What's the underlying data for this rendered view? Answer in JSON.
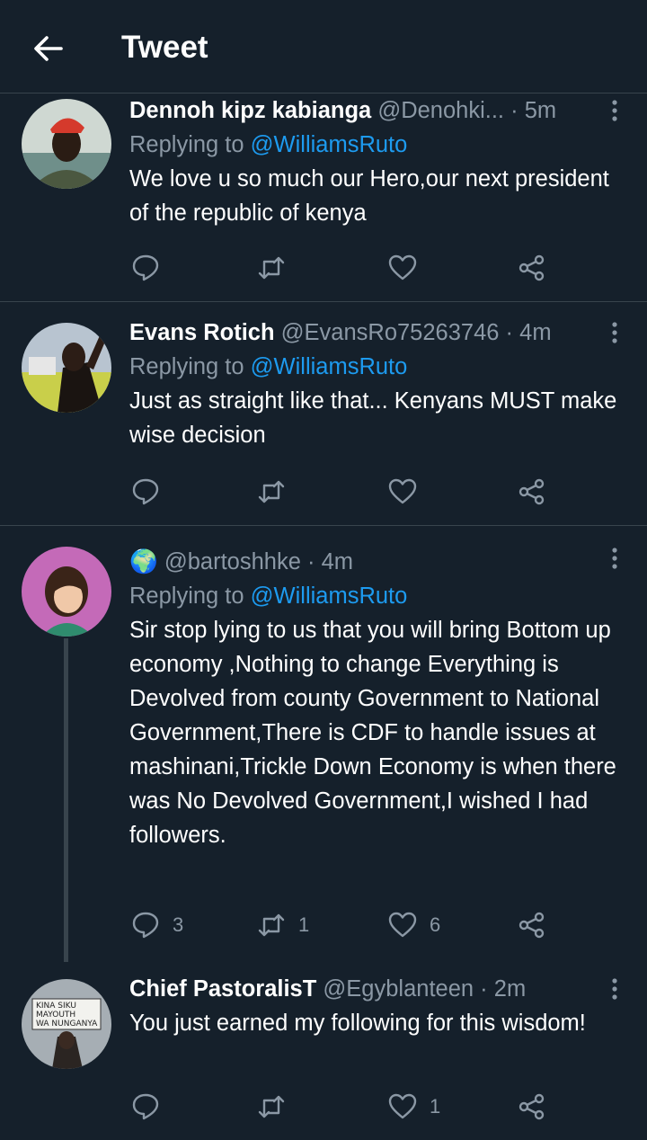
{
  "header": {
    "title": "Tweet",
    "back_icon": "arrow-left-icon"
  },
  "tweets": [
    {
      "name": "Dennoh kipz kabianga",
      "handle": "@Denohki...",
      "time": "5m",
      "replying_prefix": "Replying to ",
      "replying_to": "@WilliamsRuto",
      "text": "We love u so much our Hero,our next president of the republic of kenya",
      "replies": "",
      "retweets": "",
      "likes": ""
    },
    {
      "name": "Evans Rotich",
      "handle": "@EvansRo75263746",
      "time": "4m",
      "replying_prefix": "Replying to ",
      "replying_to": "@WilliamsRuto",
      "text": "Just as straight like that... Kenyans MUST make wise decision",
      "replies": "",
      "retweets": "",
      "likes": ""
    },
    {
      "name": "🌍",
      "handle": "@bartoshhke",
      "time": "4m",
      "replying_prefix": "Replying to ",
      "replying_to": "@WilliamsRuto",
      "text": "Sir stop lying to us that you will bring Bottom up economy ,Nothing to change Everything is Devolved from county Government to National Government,There is CDF to handle issues at mashinani,Trickle Down Economy is when there was No Devolved Government,I wished I had followers.",
      "replies": "3",
      "retweets": "1",
      "likes": "6"
    },
    {
      "name": "Chief PastoralisT",
      "handle": "@Egyblanteen",
      "time": "2m",
      "text": "You just earned my following for this wisdom!",
      "replies": "",
      "retweets": "",
      "likes": "1"
    }
  ],
  "icons": {
    "reply": "reply-icon",
    "retweet": "retweet-icon",
    "like": "heart-icon",
    "share": "share-icon",
    "more": "more-vertical-icon"
  },
  "colors": {
    "background": "#15202b",
    "secondary_text": "#8b98a5",
    "link": "#1d9bf0",
    "divider": "#38444d"
  },
  "avatar_sign_text": "Kina Siku Mayouth Wa Nunganya"
}
